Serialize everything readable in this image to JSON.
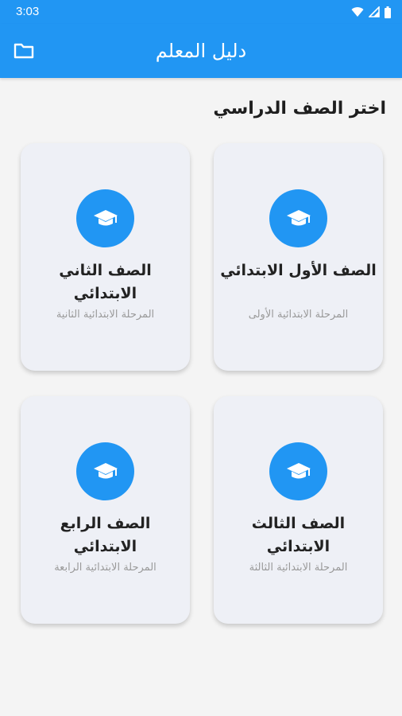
{
  "status_bar": {
    "time": "3:03"
  },
  "app_bar": {
    "title": "دليل المعلم",
    "folder_icon": "folder-icon"
  },
  "section_title": "اختر الصف الدراسي",
  "accent_color": "#2196f3",
  "cards": [
    {
      "title": "الصف الأول الابتدائي",
      "subtitle": "المرحلة الابتدائية الأولى",
      "icon": "graduation-cap-icon"
    },
    {
      "title": "الصف الثاني الابتدائي",
      "subtitle": "المرحلة الابتدائية الثانية",
      "icon": "graduation-cap-icon"
    },
    {
      "title": "الصف الثالث الابتدائي",
      "subtitle": "المرحلة الابتدائية الثالثة",
      "icon": "graduation-cap-icon"
    },
    {
      "title": "الصف الرابع الابتدائي",
      "subtitle": "المرحلة الابتدائية الرابعة",
      "icon": "graduation-cap-icon"
    }
  ]
}
